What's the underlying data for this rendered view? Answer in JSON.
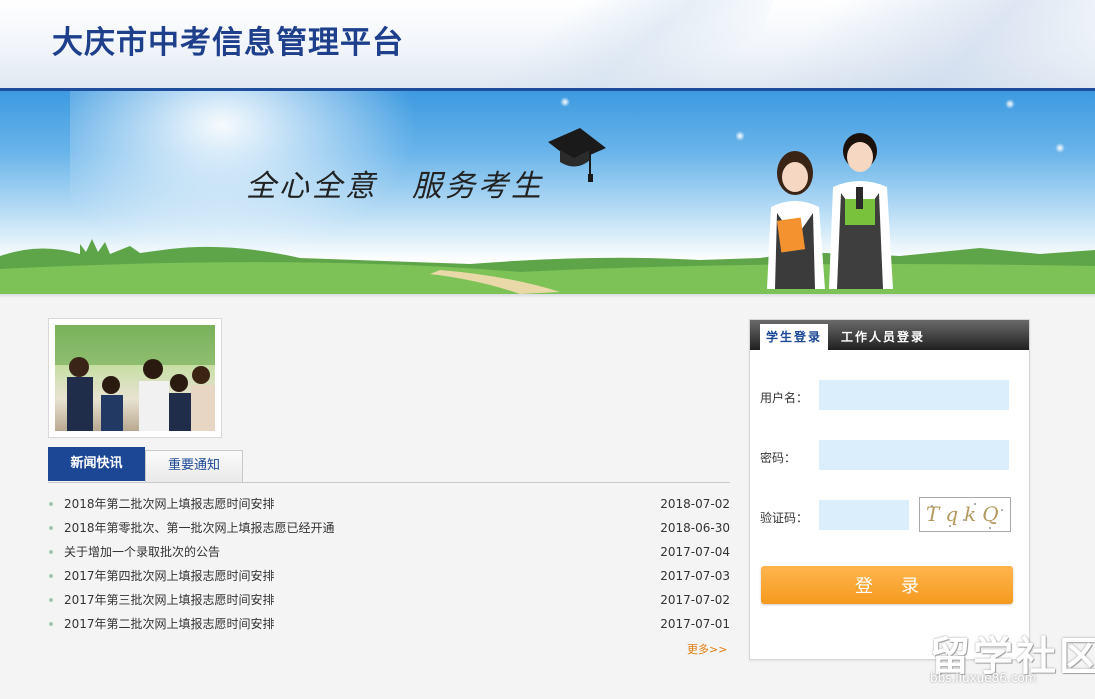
{
  "header": {
    "title": "大庆市中考信息管理平台"
  },
  "banner": {
    "slogan_left": "全心全意",
    "slogan_right": "服务考生"
  },
  "news_tabs": [
    {
      "label": "新闻快讯",
      "active": true
    },
    {
      "label": "重要通知",
      "active": false
    }
  ],
  "news": [
    {
      "title": "2018年第二批次网上填报志愿时间安排",
      "date": "2018-07-02"
    },
    {
      "title": "2018年第零批次、第一批次网上填报志愿已经开通",
      "date": "2018-06-30"
    },
    {
      "title": "关于增加一个录取批次的公告",
      "date": "2017-07-04"
    },
    {
      "title": "2017年第四批次网上填报志愿时间安排",
      "date": "2017-07-03"
    },
    {
      "title": "2017年第三批次网上填报志愿时间安排",
      "date": "2017-07-02"
    },
    {
      "title": "2017年第二批次网上填报志愿时间安排",
      "date": "2017-07-01"
    }
  ],
  "more_label": "更多>>",
  "login": {
    "tabs": [
      {
        "label": "学生登录",
        "active": true
      },
      {
        "label": "工作人员登录",
        "active": false
      }
    ],
    "username_label": "用户名：",
    "password_label": "密码：",
    "captcha_label": "验证码：",
    "captcha_text": "TqkQ",
    "submit_label": "登录"
  },
  "watermark": {
    "text": "留学社区",
    "url": "bbs.liuxue86.com"
  },
  "colors": {
    "brand_blue": "#1b4795",
    "login_orange": "#f59a1f",
    "field_bg": "#dbeefb",
    "more_orange": "#e07d0c"
  }
}
